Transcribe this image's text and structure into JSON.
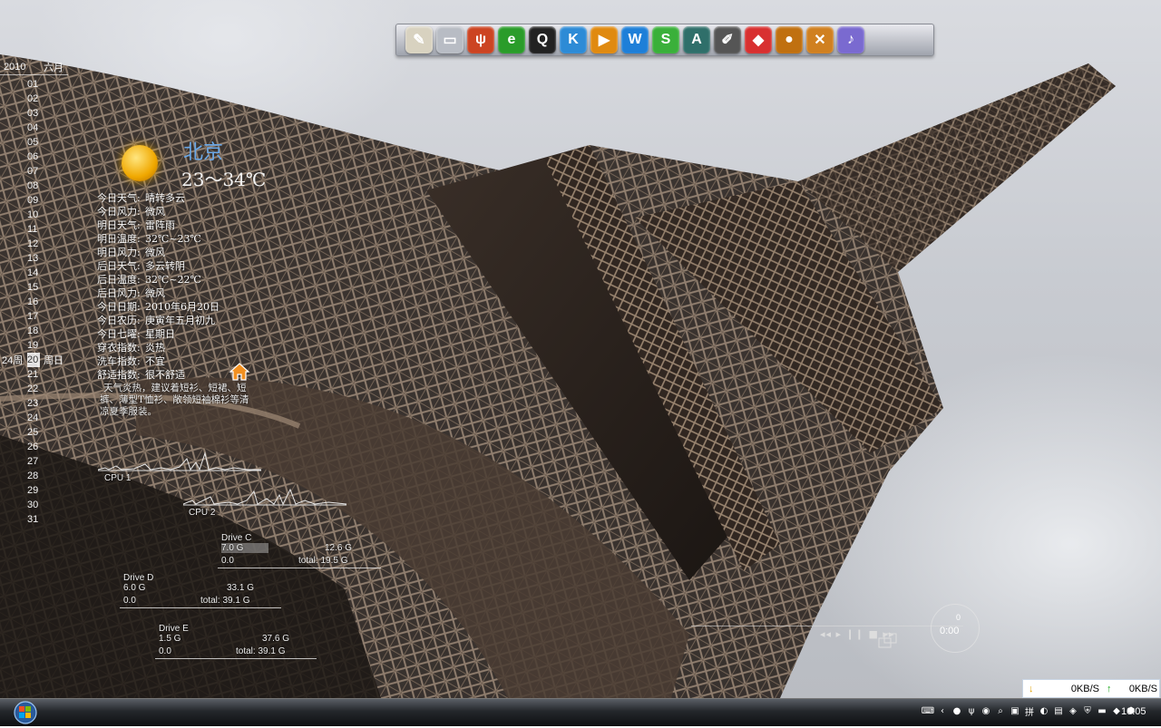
{
  "calendar": {
    "year": "2010",
    "month": "六月",
    "days": [
      "01",
      "02",
      "03",
      "04",
      "05",
      "06",
      "07",
      "08",
      "09",
      "10",
      "11",
      "12",
      "13",
      "14",
      "15",
      "16",
      "17",
      "18",
      "19",
      "20",
      "21",
      "22",
      "23",
      "24",
      "25",
      "26",
      "27",
      "28",
      "29",
      "30",
      "31"
    ],
    "today": "20",
    "week_label": "24周",
    "weekday_label": "周日"
  },
  "weather": {
    "city": "北京",
    "temp_range": "23～34℃",
    "rows": [
      {
        "label": "今日天气:",
        "value": "晴转多云"
      },
      {
        "label": "今日风力:",
        "value": "微风"
      },
      {
        "label": "明日天气:",
        "value": "雷阵雨"
      },
      {
        "label": "明日温度:",
        "value": "32℃~23℃"
      },
      {
        "label": "明日风力:",
        "value": "微风"
      },
      {
        "label": "后日天气:",
        "value": "多云转阴"
      },
      {
        "label": "后日温度:",
        "value": "32℃~22℃"
      },
      {
        "label": "后日风力:",
        "value": "微风"
      },
      {
        "label": "今日日期:",
        "value": "2010年6月20日"
      },
      {
        "label": "今日农历:",
        "value": "庚寅年五月初九"
      },
      {
        "label": "今日七曜:",
        "value": "星期日"
      },
      {
        "label": "穿衣指数:",
        "value": "炎热"
      },
      {
        "label": "洗车指数:",
        "value": "不宜"
      },
      {
        "label": "舒适指数:",
        "value": "很不舒适"
      }
    ],
    "advice": "天气炎热，建议着短衫、短裙、短裤、薄型T恤衫、敞领短袖棉衫等清凉夏季服装。"
  },
  "cpu": {
    "cpu1_label": "CPU 1",
    "cpu2_label": "CPU 2"
  },
  "drives": [
    {
      "name": "Drive C",
      "used": "7.0 G",
      "free": "12.6 G",
      "zero": "0.0",
      "total": "total: 19.5 G"
    },
    {
      "name": "Drive D",
      "used": "6.0 G",
      "free": "33.1 G",
      "zero": "0.0",
      "total": "total: 39.1 G"
    },
    {
      "name": "Drive E",
      "used": "1.5 G",
      "free": "37.6 G",
      "zero": "0.0",
      "total": "total: 39.1 G"
    }
  ],
  "media": {
    "controls": "◂◂ ▸ ❙❙ ■ ▸▸",
    "time": "0:00",
    "counter": "0"
  },
  "netspeed": {
    "down": "0KB/S",
    "up": "0KB/S"
  },
  "dock": {
    "icons": [
      {
        "name": "notepad-icon",
        "glyph": "✎",
        "color": "#d8d2c0"
      },
      {
        "name": "folder-icon",
        "glyph": "▭",
        "color": "#b8bcc4"
      },
      {
        "name": "network-icon",
        "glyph": "ψ",
        "color": "#cc4422"
      },
      {
        "name": "ie-icon",
        "glyph": "e",
        "color": "#2a9c2a"
      },
      {
        "name": "qq-icon",
        "glyph": "Q",
        "color": "#222"
      },
      {
        "name": "kugou-icon",
        "glyph": "K",
        "color": "#2d8bd6"
      },
      {
        "name": "media-icon",
        "glyph": "▶",
        "color": "#e08a10"
      },
      {
        "name": "wps-writer-icon",
        "glyph": "W",
        "color": "#1e7fd8"
      },
      {
        "name": "wps-spreadsheet-icon",
        "glyph": "S",
        "color": "#3ab03a"
      },
      {
        "name": "text-editor-icon",
        "glyph": "A",
        "color": "#2f6f6a"
      },
      {
        "name": "drawing-icon",
        "glyph": "✐",
        "color": "#555"
      },
      {
        "name": "box-icon",
        "glyph": "◆",
        "color": "#d83030"
      },
      {
        "name": "orb-icon",
        "glyph": "●",
        "color": "#c07010"
      },
      {
        "name": "tools-icon",
        "glyph": "✕",
        "color": "#d08020"
      },
      {
        "name": "music-icon",
        "glyph": "♪",
        "color": "#7a6ad0"
      }
    ]
  },
  "taskbar": {
    "clock": "10:05"
  }
}
